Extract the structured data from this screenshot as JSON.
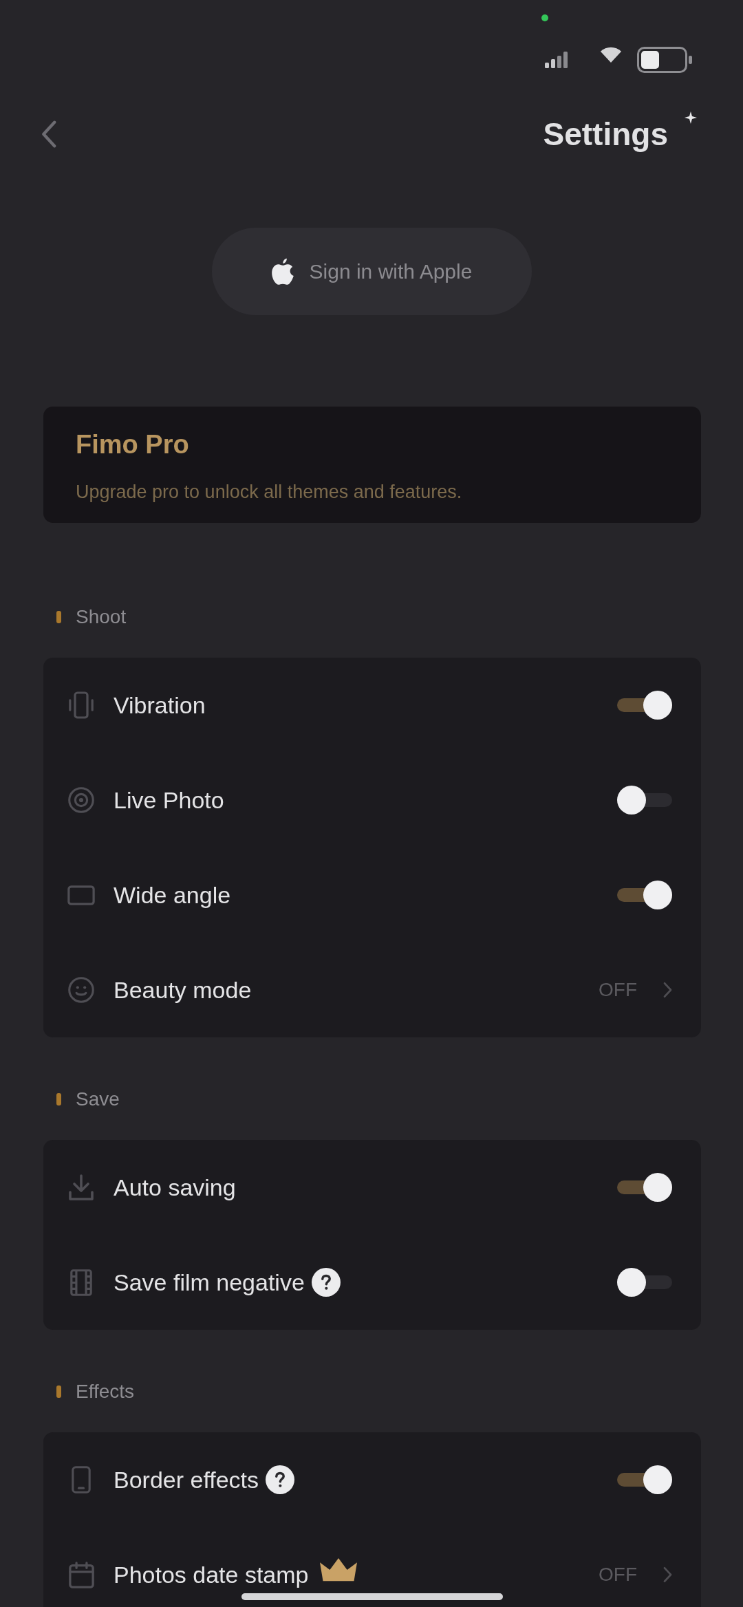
{
  "header": {
    "title": "Settings"
  },
  "sign_in": {
    "label": "Sign in with Apple"
  },
  "pro_card": {
    "title": "Fimo Pro",
    "subtitle": "Upgrade pro to unlock all themes and features."
  },
  "sections": [
    {
      "title": "Shoot",
      "rows": [
        {
          "kind": "toggle",
          "label": "Vibration",
          "on": true,
          "help": false,
          "pro": false
        },
        {
          "kind": "toggle",
          "label": "Live Photo",
          "on": false,
          "help": false,
          "pro": false
        },
        {
          "kind": "toggle",
          "label": "Wide angle",
          "on": true,
          "help": false,
          "pro": false
        },
        {
          "kind": "value",
          "label": "Beauty mode",
          "value": "OFF",
          "help": false,
          "pro": false
        }
      ]
    },
    {
      "title": "Save",
      "rows": [
        {
          "kind": "toggle",
          "label": "Auto saving",
          "on": true,
          "help": false,
          "pro": false
        },
        {
          "kind": "toggle",
          "label": "Save film negative",
          "on": false,
          "help": true,
          "pro": false
        }
      ]
    },
    {
      "title": "Effects",
      "rows": [
        {
          "kind": "toggle",
          "label": "Border effects",
          "on": true,
          "help": true,
          "pro": false
        },
        {
          "kind": "value",
          "label": "Photos date stamp",
          "value": "OFF",
          "help": false,
          "pro": true
        }
      ]
    }
  ]
}
